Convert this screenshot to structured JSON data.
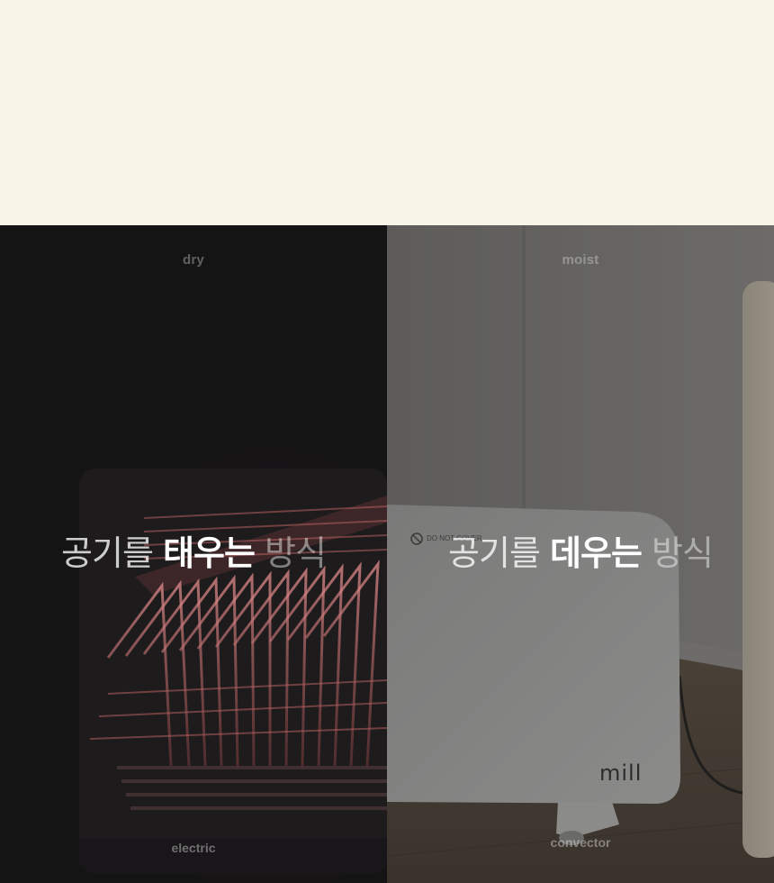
{
  "comparison": {
    "left": {
      "top_label": "dry",
      "headline_prefix": "공기를",
      "headline_emphasis": "태우는",
      "headline_suffix": "방식",
      "bottom_label": "electric"
    },
    "right": {
      "top_label": "moist",
      "headline_prefix": "공기를",
      "headline_emphasis": "데우는",
      "headline_suffix": "방식",
      "bottom_label": "convector",
      "heater_brand": "mill",
      "heater_warning": "DO NOT COVER"
    }
  },
  "colors": {
    "top_band": "#f8f5e8",
    "left_panel": "#151415",
    "right_panel": "#5f5e5c",
    "heating_coil": "#d9767a"
  }
}
